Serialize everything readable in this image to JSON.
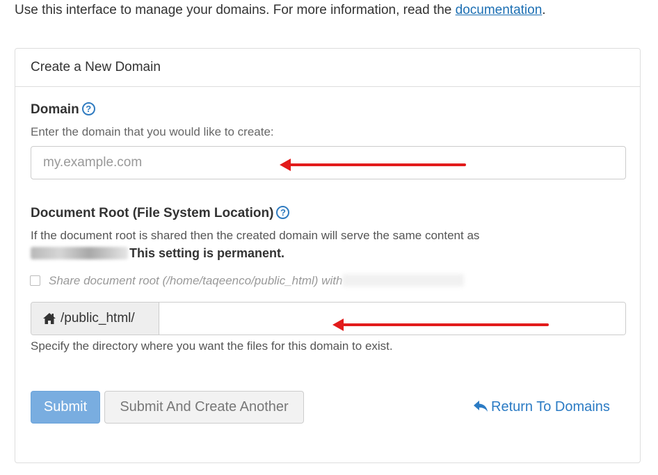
{
  "intro": {
    "text": "Use this interface to manage your domains. For more information, read the ",
    "link": "documentation",
    "end": "."
  },
  "panel": {
    "heading": "Create a New Domain"
  },
  "domain": {
    "label": "Domain",
    "hint": "Enter the domain that you would like to create:",
    "placeholder": "my.example.com"
  },
  "docroot": {
    "label": "Document Root (File System Location)",
    "desc_line1": "If the document root is shared then the created domain will serve the same content as",
    "permanent": "This setting is permanent.",
    "checkbox_label": "Share document root (/home/taqeenco/public_html) with",
    "prefix": "/public_html/",
    "field_value": "",
    "help_text": "Specify the directory where you want the files for this domain to exist."
  },
  "actions": {
    "submit": "Submit",
    "submit_another": "Submit And Create Another",
    "return": "Return To Domains"
  },
  "colors": {
    "link": "#1c6fb3",
    "primary_button": "#79ade0",
    "annotation_arrow": "#e21b1b"
  },
  "icons": {
    "help": "question-circle-icon",
    "home": "home-icon",
    "return": "reply-arrow-icon"
  }
}
